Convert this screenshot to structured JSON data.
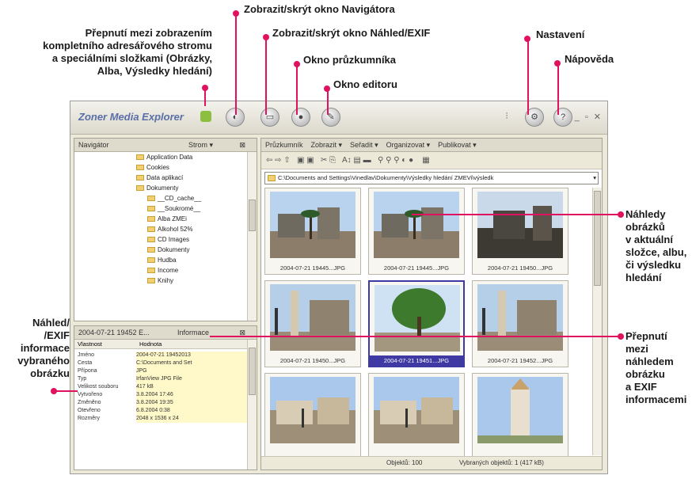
{
  "annotations": {
    "navigator_toggle": "Zobrazit/skrýt okno Navigátora",
    "preview_exif_toggle": "Zobrazit/skrýt okno Náhled/EXIF",
    "explorer_window": "Okno průzkumníka",
    "editor_window": "Okno editoru",
    "settings": "Nastavení",
    "help": "Nápověda",
    "tree_switch": [
      "Přepnutí mezi zobrazením",
      "kompletního adresářového stromu",
      "a speciálními složkami (Obrázky,",
      "Alba, Výsledky hledání)"
    ],
    "thumbnails": [
      "Náhledy",
      "obrázků",
      "v aktuální",
      "složce, albu,",
      "či výsledku",
      "hledání"
    ],
    "switch_preview_exif": [
      "Přepnutí",
      "mezi",
      "náhledem",
      "obrázku",
      "a EXIF",
      "informacemi"
    ],
    "preview_exif_info": [
      "Náhled/",
      "/EXIF",
      "informace",
      "vybraného",
      "obrázku"
    ]
  },
  "app": {
    "title": "Zoner Media Explorer",
    "navigator": {
      "header": "Navigátor",
      "header_right": "Strom ▾",
      "tree": [
        {
          "indent": 1,
          "label": "Application Data"
        },
        {
          "indent": 1,
          "label": "Cookies"
        },
        {
          "indent": 1,
          "label": "Data aplikací"
        },
        {
          "indent": 1,
          "label": "Dokumenty"
        },
        {
          "indent": 2,
          "label": "__CD_cache__"
        },
        {
          "indent": 2,
          "label": "__Soukromé__"
        },
        {
          "indent": 2,
          "label": "Alba ZMEi"
        },
        {
          "indent": 2,
          "label": "Alkohol 52%"
        },
        {
          "indent": 2,
          "label": "CD Images"
        },
        {
          "indent": 2,
          "label": "Dokumenty"
        },
        {
          "indent": 2,
          "label": "Hudba"
        },
        {
          "indent": 2,
          "label": "Income"
        },
        {
          "indent": 2,
          "label": "Knihy"
        }
      ]
    },
    "info_panel": {
      "header": "2004-07-21 19452 E...",
      "tab": "Informace",
      "col_key": "Vlastnost",
      "col_val": "Hodnota",
      "rows": [
        {
          "k": "Jméno",
          "v": "2004-07-21 19452013"
        },
        {
          "k": "Cesta",
          "v": "C:\\Documents and Set"
        },
        {
          "k": "Přípona",
          "v": "JPG"
        },
        {
          "k": "Typ",
          "v": "IrfanView JPG File"
        },
        {
          "k": "Velikost souboru",
          "v": "417 kB"
        },
        {
          "k": "Vytvořeno",
          "v": "3.8.2004 17:46"
        },
        {
          "k": "Změněno",
          "v": "3.8.2004 19:35"
        },
        {
          "k": "Otevřeno",
          "v": "6.8.2004 0:38"
        },
        {
          "k": "Rozměry",
          "v": "2048 x 1536 x 24"
        }
      ]
    },
    "explorer": {
      "tabs": [
        "Průzkumník",
        "Zobrazit ▾",
        "Seřadit ▾",
        "Organizovat ▾",
        "Publikovat ▾"
      ],
      "address": "C:\\Documents and Settings\\Vinedlav\\Dokumenty\\Výsledky hledání ZMEVi\\výsledk",
      "thumbnails": [
        {
          "caption": "2004-07-21 19445...JPG",
          "scene": "palm",
          "selected": false
        },
        {
          "caption": "2004-07-21 19445...JPG",
          "scene": "palm",
          "selected": false
        },
        {
          "caption": "2004-07-21 19450...JPG",
          "scene": "dark",
          "selected": false
        },
        {
          "caption": "2004-07-21 19450...JPG",
          "scene": "tower",
          "selected": false
        },
        {
          "caption": "2004-07-21 19451...JPG",
          "scene": "tree",
          "selected": true
        },
        {
          "caption": "2004-07-21 19452...JPG",
          "scene": "tower",
          "selected": false
        },
        {
          "caption": "",
          "scene": "street",
          "selected": false
        },
        {
          "caption": "",
          "scene": "street",
          "selected": false
        },
        {
          "caption": "",
          "scene": "church",
          "selected": false
        }
      ],
      "status_left": "Objektů: 100",
      "status_right": "Vybraných objektů: 1 (417 kB)"
    }
  }
}
